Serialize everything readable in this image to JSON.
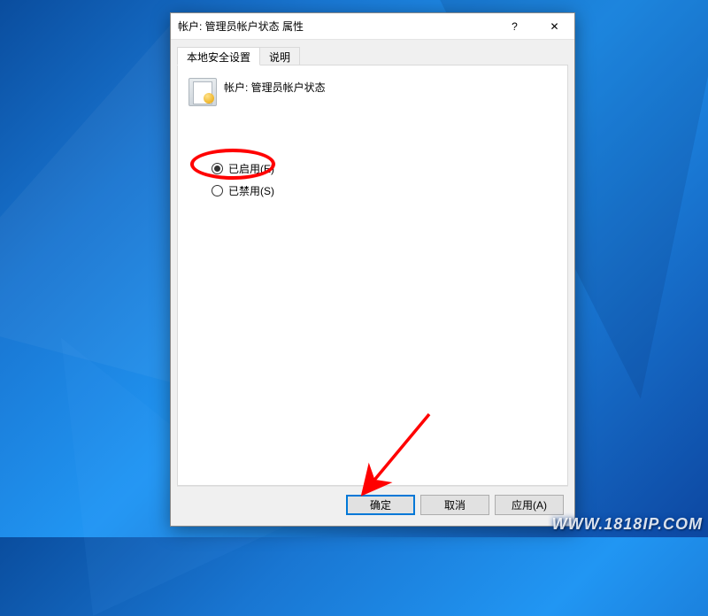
{
  "window": {
    "title": "帐户: 管理员帐户状态 属性",
    "help_icon": "?",
    "close_icon": "✕"
  },
  "tabs": {
    "active": "本地安全设置",
    "inactive": "说明"
  },
  "policy": {
    "icon_name": "security-policy-icon",
    "title": "帐户: 管理员帐户状态"
  },
  "options": {
    "enabled": {
      "label": "已启用(E)",
      "checked": true
    },
    "disabled": {
      "label": "已禁用(S)",
      "checked": false
    }
  },
  "buttons": {
    "ok": "确定",
    "cancel": "取消",
    "apply": "应用(A)"
  },
  "watermark": "WWW.1818IP.COM",
  "annotations": {
    "ellipse_color": "#ff0000",
    "arrow_color": "#ff0000"
  }
}
